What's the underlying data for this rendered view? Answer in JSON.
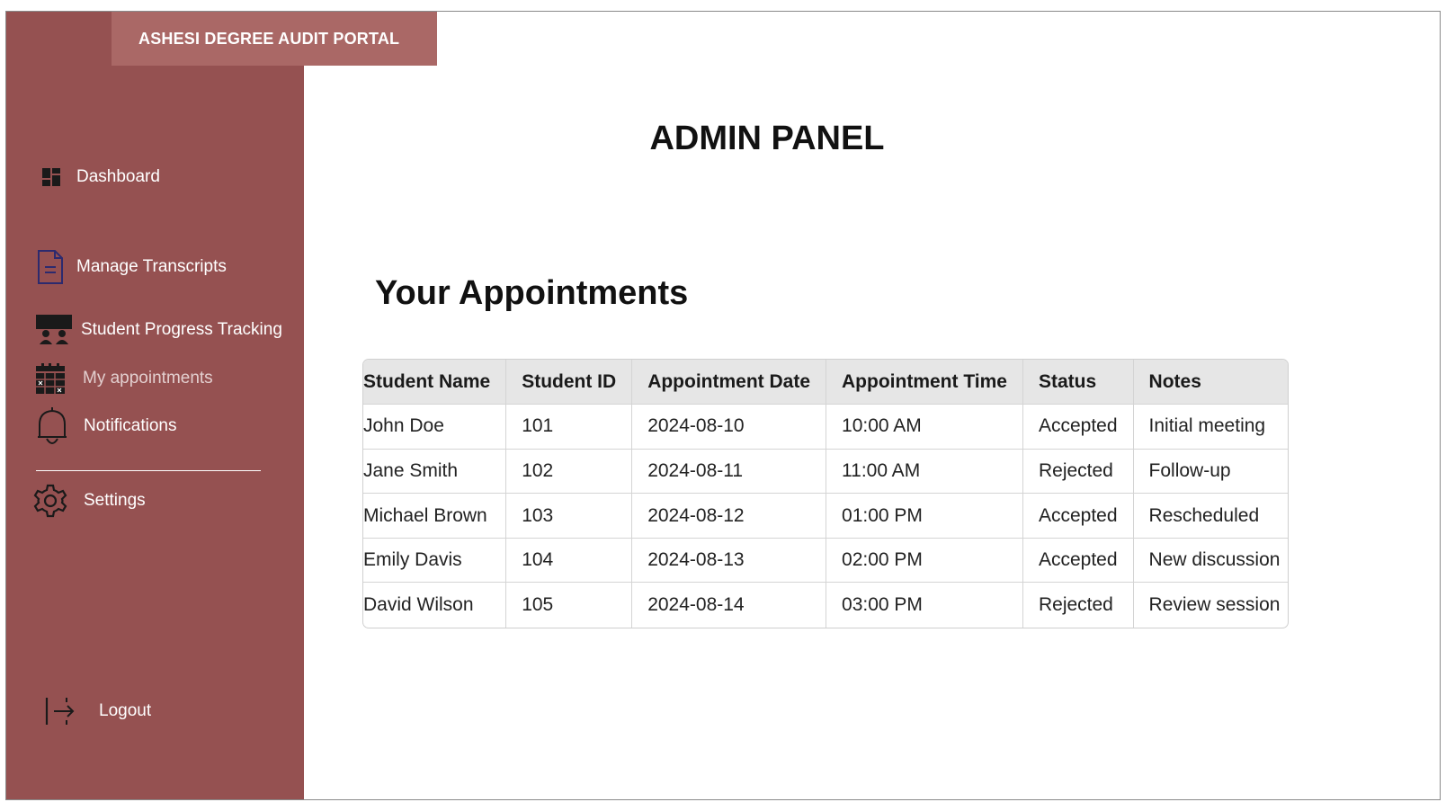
{
  "app": {
    "brand": "ASHESI DEGREE AUDIT PORTAL"
  },
  "sidebar": {
    "items": [
      {
        "label": "Dashboard",
        "icon": "dashboard-icon"
      },
      {
        "label": "Manage Transcripts",
        "icon": "document-icon"
      },
      {
        "label": "Student Progress Tracking",
        "icon": "presentation-icon"
      },
      {
        "label": "My appointments",
        "icon": "calendar-icon",
        "active": true
      },
      {
        "label": "Notifications",
        "icon": "bell-icon"
      },
      {
        "label": "Settings",
        "icon": "gear-icon"
      }
    ],
    "logout": {
      "label": "Logout",
      "icon": "logout-icon"
    }
  },
  "main": {
    "title": "ADMIN PANEL",
    "section_title": "Your Appointments",
    "table": {
      "columns": [
        "Student Name",
        "Student ID",
        "Appointment Date",
        "Appointment Time",
        "Status",
        "Notes"
      ],
      "rows": [
        [
          "John Doe",
          "101",
          "2024-08-10",
          "10:00 AM",
          "Accepted",
          "Initial meeting"
        ],
        [
          "Jane Smith",
          "102",
          "2024-08-11",
          "11:00 AM",
          "Rejected",
          "Follow-up"
        ],
        [
          "Michael Brown",
          "103",
          "2024-08-12",
          "01:00 PM",
          "Accepted",
          "Rescheduled"
        ],
        [
          "Emily Davis",
          "104",
          "2024-08-13",
          "02:00 PM",
          "Accepted",
          "New discussion"
        ],
        [
          "David Wilson",
          "105",
          "2024-08-14",
          "03:00 PM",
          "Rejected",
          "Review session"
        ]
      ]
    }
  },
  "colors": {
    "sidebar": "#955151",
    "brand_bar": "#aa6866",
    "header_row": "#e6e6e6"
  }
}
